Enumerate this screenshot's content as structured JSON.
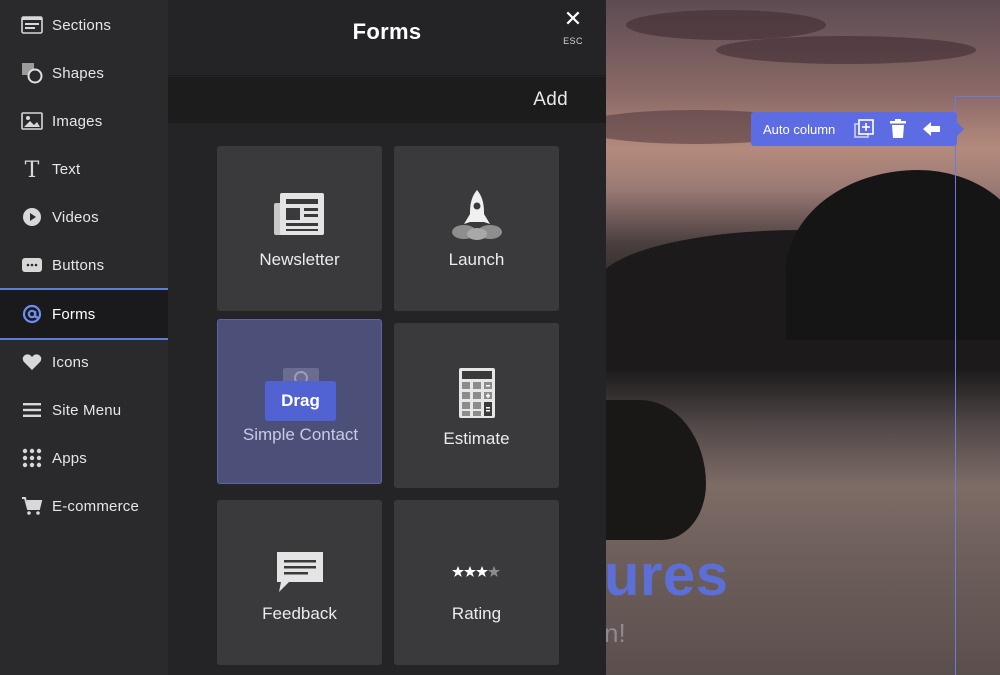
{
  "sidebar": {
    "items": [
      {
        "label": "Sections",
        "icon": "sections-icon"
      },
      {
        "label": "Shapes",
        "icon": "shapes-icon"
      },
      {
        "label": "Images",
        "icon": "image-icon"
      },
      {
        "label": "Text",
        "icon": "text-icon"
      },
      {
        "label": "Videos",
        "icon": "play-icon"
      },
      {
        "label": "Buttons",
        "icon": "button-icon"
      },
      {
        "label": "Forms",
        "icon": "at-icon",
        "active": true
      },
      {
        "label": "Icons",
        "icon": "heart-icon"
      },
      {
        "label": "Site Menu",
        "icon": "menu-icon"
      },
      {
        "label": "Apps",
        "icon": "grid-icon"
      },
      {
        "label": "E-commerce",
        "icon": "cart-icon"
      }
    ]
  },
  "panel": {
    "title": "Forms",
    "close_hint": "ESC",
    "add_label": "Add",
    "tiles": [
      {
        "label": "Newsletter",
        "icon": "newspaper-icon"
      },
      {
        "label": "Launch",
        "icon": "rocket-icon"
      },
      {
        "label": "Simple Contact",
        "icon": "contact-icon",
        "state": "dragging"
      },
      {
        "label": "Estimate",
        "icon": "calculator-icon"
      },
      {
        "label": "Feedback",
        "icon": "chat-icon"
      },
      {
        "label": "Rating",
        "icon": "stars-icon"
      }
    ],
    "drag_badge": "Drag"
  },
  "canvas": {
    "heading_fragment": "ures",
    "sub_fragment": "n!",
    "toolbar": {
      "label": "Auto column"
    },
    "accent": "#5e6ce4"
  }
}
